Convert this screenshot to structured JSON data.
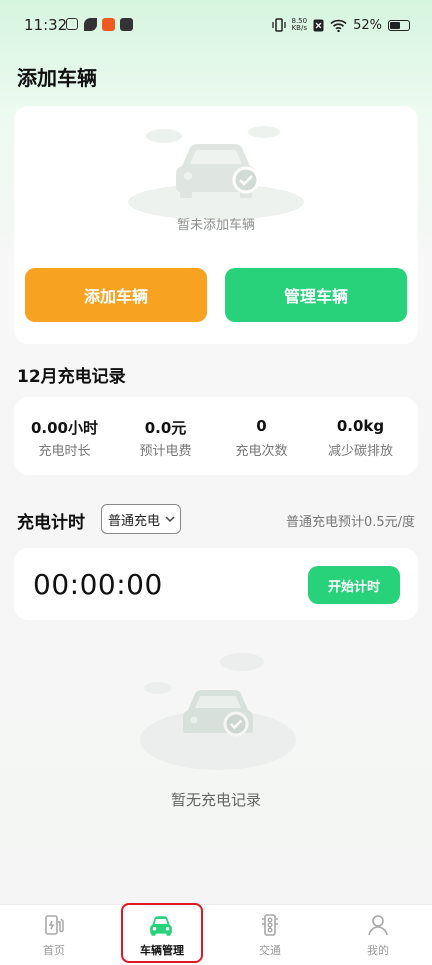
{
  "status_bar": {
    "time": "11:32",
    "net_speed_top": "8.50",
    "net_speed_bottom": "KB/s",
    "battery": "52%"
  },
  "header": {
    "title": "添加车辆"
  },
  "add_card": {
    "empty_text": "暂未添加车辆",
    "add_button": "添加车辆",
    "manage_button": "管理车辆",
    "add_color": "#f8a222",
    "manage_color": "#27d27b"
  },
  "records": {
    "title": "12月充电记录",
    "stats": [
      {
        "value": "0.00小时",
        "label": "充电时长"
      },
      {
        "value": "0.0元",
        "label": "预计电费"
      },
      {
        "value": "0",
        "label": "充电次数"
      },
      {
        "value": "0.0kg",
        "label": "减少碳排放"
      }
    ]
  },
  "timer_section": {
    "title": "充电计时",
    "mode": "普通充电",
    "price_note": "普通充电预计0.5元/度",
    "time": "00:00:00",
    "start_button": "开始计时"
  },
  "empty_records": {
    "text": "暂无充电记录"
  },
  "tabs": [
    {
      "label": "首页",
      "icon": "charging-station-icon",
      "active": false
    },
    {
      "label": "车辆管理",
      "icon": "car-icon",
      "active": true
    },
    {
      "label": "交通",
      "icon": "traffic-light-icon",
      "active": false
    },
    {
      "label": "我的",
      "icon": "person-icon",
      "active": false
    }
  ],
  "colors": {
    "accent": "#27d27b",
    "highlight_box": "#e01823"
  }
}
